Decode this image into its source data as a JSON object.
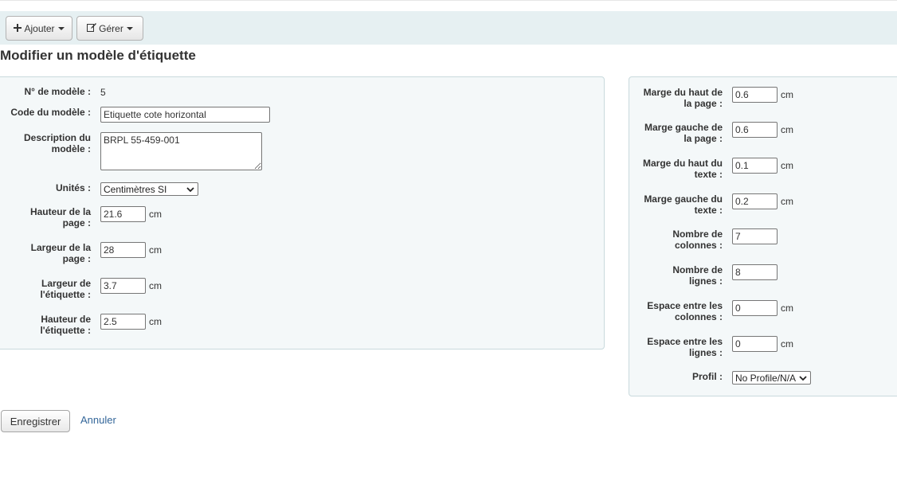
{
  "toolbar": {
    "add_label": "Ajouter",
    "manage_label": "Gérer",
    "add_icon": "plus-icon",
    "manage_icon": "edit-icon"
  },
  "page_title": "Modifier un modèle d'étiquette",
  "left_form": {
    "template_id": {
      "label": "N° de modèle :",
      "value": "5"
    },
    "template_code": {
      "label": "Code du modèle :",
      "value": "Etiquette cote horizontal"
    },
    "description": {
      "label_1": "Description du",
      "label_2": "modèle :",
      "value": "BRPL 55-459-001"
    },
    "units": {
      "label": "Unités :",
      "value": "Centimètres SI"
    },
    "page_height": {
      "label_1": "Hauteur de la",
      "label_2": "page :",
      "value": "21.6",
      "unit": "cm"
    },
    "page_width": {
      "label_1": "Largeur de la",
      "label_2": "page :",
      "value": "28",
      "unit": "cm"
    },
    "label_width": {
      "label_1": "Largeur de",
      "label_2": "l'étiquette :",
      "value": "3.7",
      "unit": "cm"
    },
    "label_height": {
      "label_1": "Hauteur de",
      "label_2": "l'étiquette :",
      "value": "2.5",
      "unit": "cm"
    }
  },
  "right_form": {
    "top_page_margin": {
      "label_1": "Marge du haut de",
      "label_2": "la page :",
      "value": "0.6",
      "unit": "cm"
    },
    "left_page_margin": {
      "label_1": "Marge gauche de",
      "label_2": "la page :",
      "value": "0.6",
      "unit": "cm"
    },
    "top_text_margin": {
      "label_1": "Marge du haut du",
      "label_2": "texte :",
      "value": "0.1",
      "unit": "cm"
    },
    "left_text_margin": {
      "label_1": "Marge gauche du",
      "label_2": "texte :",
      "value": "0.2",
      "unit": "cm"
    },
    "columns": {
      "label_1": "Nombre de",
      "label_2": "colonnes :",
      "value": "7"
    },
    "rows": {
      "label_1": "Nombre de",
      "label_2": "lignes :",
      "value": "8"
    },
    "col_gap": {
      "label_1": "Espace entre les",
      "label_2": "colonnes :",
      "value": "0",
      "unit": "cm"
    },
    "row_gap": {
      "label_1": "Espace entre les",
      "label_2": "lignes :",
      "value": "0",
      "unit": "cm"
    },
    "profile": {
      "label": "Profil :",
      "value": "No Profile/N/A"
    }
  },
  "actions": {
    "save_label": "Enregistrer",
    "cancel_label": "Annuler"
  }
}
